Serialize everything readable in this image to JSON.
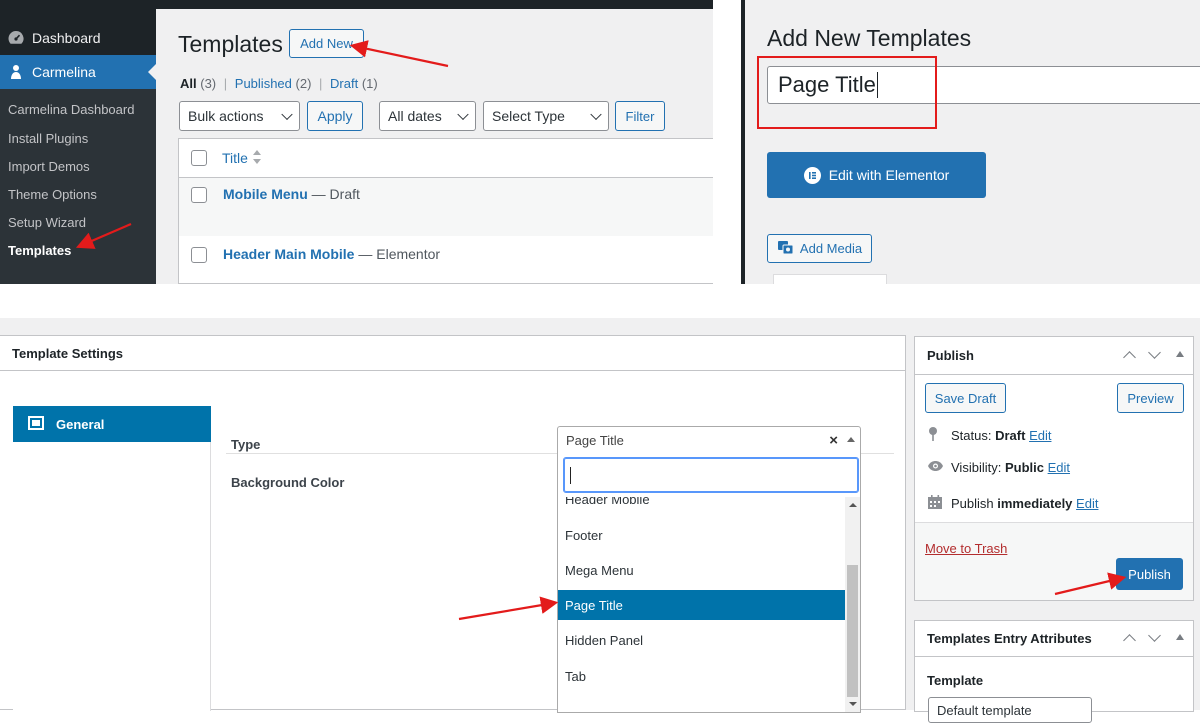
{
  "sidebar": {
    "items": [
      {
        "label": "Dashboard",
        "icon": "dashboard-icon"
      },
      {
        "label": "Carmelina",
        "icon": "carmelina-icon"
      }
    ],
    "submenu": [
      "Carmelina Dashboard",
      "Install Plugins",
      "Import Demos",
      "Theme Options",
      "Setup Wizard",
      "Templates"
    ]
  },
  "templates_list": {
    "title": "Templates",
    "add_new_label": "Add New",
    "filters": {
      "all": "All",
      "all_count": "(3)",
      "published": "Published",
      "published_count": "(2)",
      "draft": "Draft",
      "draft_count": "(1)",
      "sep": "|"
    },
    "bulk_actions": "Bulk actions",
    "apply_label": "Apply",
    "all_dates": "All dates",
    "select_type": "Select Type",
    "filter_label": "Filter",
    "column_title": "Title",
    "rows": [
      {
        "title": "Mobile Menu",
        "state": "— Draft"
      },
      {
        "title": "Header Main Mobile",
        "state": "— Elementor"
      }
    ]
  },
  "editor": {
    "heading": "Add New Templates",
    "title_value": "Page Title",
    "elementor_button": "Edit with Elementor",
    "add_media": "Add Media"
  },
  "template_settings": {
    "heading": "Template Settings",
    "tab_general": "General",
    "type_label": "Type",
    "background_color_label": "Background Color",
    "type_value": "Page Title",
    "clear_glyph": "×",
    "search_value": "",
    "options": [
      {
        "label": "Header Mobile",
        "selected": false
      },
      {
        "label": "Footer",
        "selected": false
      },
      {
        "label": "Mega Menu",
        "selected": false
      },
      {
        "label": "Page Title",
        "selected": true
      },
      {
        "label": "Hidden Panel",
        "selected": false
      },
      {
        "label": "Tab",
        "selected": false
      }
    ]
  },
  "publish_box": {
    "heading": "Publish",
    "save_draft": "Save Draft",
    "preview": "Preview",
    "status_label": "Status:",
    "status_value": "Draft",
    "visibility_label": "Visibility:",
    "visibility_value": "Public",
    "publish_label": "Publish",
    "publish_value": "immediately",
    "edit_link": "Edit",
    "move_to_trash": "Move to Trash",
    "publish_button": "Publish"
  },
  "attributes_box": {
    "heading": "Templates Entry Attributes",
    "template_label": "Template",
    "template_value": "Default template"
  },
  "colors": {
    "wp_blue": "#2271b1",
    "admin_dark": "#1d2327",
    "annotation_red": "#e31b1b",
    "dropdown_selected": "#0073aa"
  }
}
